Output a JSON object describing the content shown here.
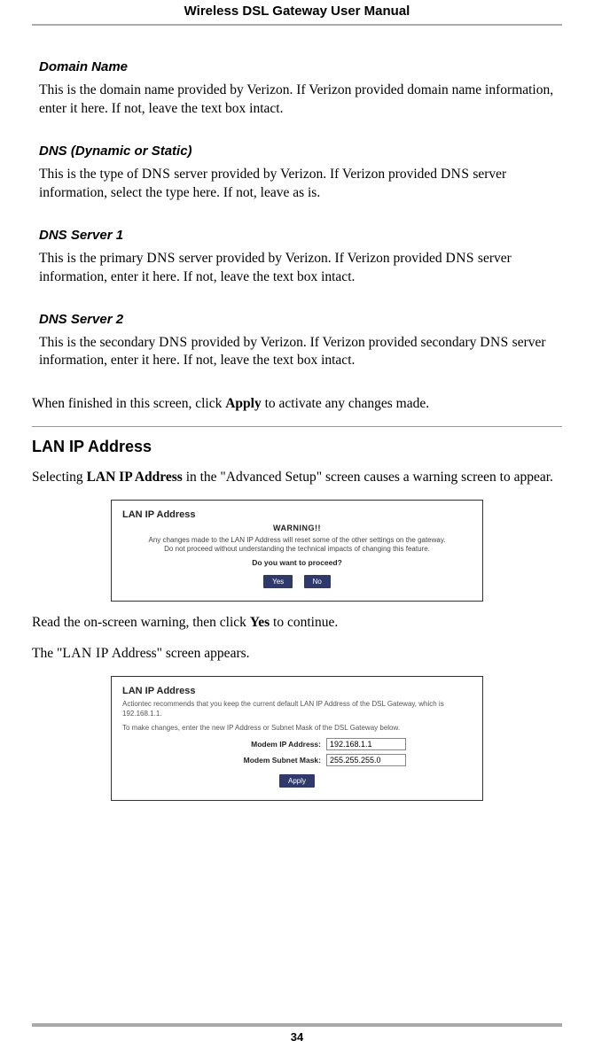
{
  "header": {
    "title": "Wireless DSL Gateway User Manual"
  },
  "sections": {
    "domain_name": {
      "title": "Domain Name",
      "body": "This is the domain name provided by Verizon. If Verizon provided domain name information, enter it here. If not, leave the text box intact."
    },
    "dns_type": {
      "title": "DNS (Dynamic or Static)",
      "body_a": "This is the type of ",
      "body_b": " server provided by Verizon. If Verizon provided ",
      "body_c": " server information, select the type here. If not, leave as is."
    },
    "dns1": {
      "title": "DNS Server 1",
      "body_a": "This is the primary ",
      "body_b": " server provided by Verizon. If Verizon provided ",
      "body_c": " server information, enter it here. If not, leave the text box intact."
    },
    "dns2": {
      "title": "DNS Server 2",
      "body_a": "This is the secondary ",
      "body_b": " provided by Verizon. If Verizon provided secondary ",
      "body_c": " server information, enter it here. If not, leave the text box intact."
    }
  },
  "finish": {
    "a": "When finished in this screen, click ",
    "apply": "Apply",
    "b": " to activate any changes made."
  },
  "lan": {
    "heading": "LAN IP Address",
    "p1_a": "Selecting ",
    "p1_bold": "LAN IP Address",
    "p1_b": " in the \"Advanced Setup\" screen causes a warning screen to appear.",
    "p2_a": "Read the on-screen warning, then click ",
    "p2_bold": "Yes",
    "p2_b": " to continue.",
    "p3_a": "The \"",
    "p3_sc": "LAN IP",
    "p3_b": " Address\" screen appears."
  },
  "shot1": {
    "title": "LAN IP Address",
    "warn_hdr": "WARNING!!",
    "warn_l1": "Any changes made to the LAN IP Address will reset some of the other settings on the gateway.",
    "warn_l2": "Do not proceed without understanding the technical impacts of changing this feature.",
    "proceed": "Do you want to proceed?",
    "yes": "Yes",
    "no": "No"
  },
  "shot2": {
    "title": "LAN IP Address",
    "desc1": "Actiontec recommends that you keep the current default LAN IP Address of the DSL Gateway, which is 192.168.1.1.",
    "desc2": "To make changes, enter the new IP Address or Subnet Mask of the DSL Gateway below.",
    "ip_label": "Modem IP Address:",
    "ip_value": "192.168.1.1",
    "mask_label": "Modem Subnet Mask:",
    "mask_value": "255.255.255.0",
    "apply": "Apply"
  },
  "sc_dns": "DNS",
  "page_number": "34"
}
